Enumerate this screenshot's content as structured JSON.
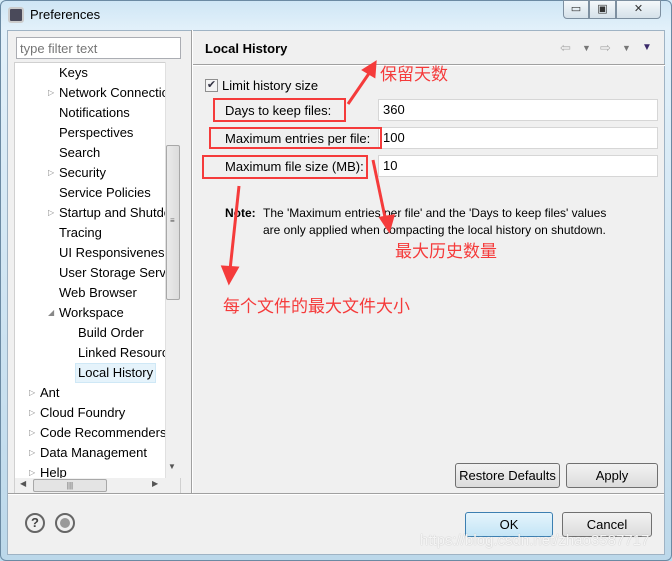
{
  "window": {
    "title": "Preferences",
    "minimize": "▭",
    "maximize": "▣",
    "close": "✕"
  },
  "filter": {
    "placeholder": "type filter text"
  },
  "tree": [
    {
      "label": "Keys",
      "level": 1,
      "expander": ""
    },
    {
      "label": "Network Connections",
      "level": 1,
      "expander": "▷"
    },
    {
      "label": "Notifications",
      "level": 1,
      "expander": ""
    },
    {
      "label": "Perspectives",
      "level": 1,
      "expander": ""
    },
    {
      "label": "Search",
      "level": 1,
      "expander": ""
    },
    {
      "label": "Security",
      "level": 1,
      "expander": "▷"
    },
    {
      "label": "Service Policies",
      "level": 1,
      "expander": ""
    },
    {
      "label": "Startup and Shutdown",
      "level": 1,
      "expander": "▷"
    },
    {
      "label": "Tracing",
      "level": 1,
      "expander": ""
    },
    {
      "label": "UI Responsiveness",
      "level": 1,
      "expander": ""
    },
    {
      "label": "User Storage Service",
      "level": 1,
      "expander": ""
    },
    {
      "label": "Web Browser",
      "level": 1,
      "expander": ""
    },
    {
      "label": "Workspace",
      "level": 1,
      "expander": "◢"
    },
    {
      "label": "Build Order",
      "level": 2,
      "expander": ""
    },
    {
      "label": "Linked Resources",
      "level": 2,
      "expander": ""
    },
    {
      "label": "Local History",
      "level": 2,
      "expander": "",
      "selected": true
    },
    {
      "label": "Ant",
      "level": 0,
      "expander": "▷"
    },
    {
      "label": "Cloud Foundry",
      "level": 0,
      "expander": "▷"
    },
    {
      "label": "Code Recommenders",
      "level": 0,
      "expander": "▷"
    },
    {
      "label": "Data Management",
      "level": 0,
      "expander": "▷"
    },
    {
      "label": "Help",
      "level": 0,
      "expander": "▷"
    }
  ],
  "page": {
    "title": "Local History",
    "limit_checkbox": {
      "label": "Limit history size",
      "checked": true
    },
    "fields": [
      {
        "label": "Days to keep files:",
        "value": "360"
      },
      {
        "label": "Maximum entries per file:",
        "value": "100"
      },
      {
        "label": "Maximum file size (MB):",
        "value": "10"
      }
    ],
    "note_label": "Note:",
    "note_line1": "The 'Maximum entries per file' and the 'Days to keep files' values",
    "note_line2": "are only applied when compacting the local history on shutdown.",
    "restore_defaults": "Restore Defaults",
    "apply": "Apply"
  },
  "footer": {
    "ok": "OK",
    "cancel": "Cancel",
    "help": "?"
  },
  "annotations": {
    "days": "保留天数",
    "entries": "最大历史数量",
    "size": "每个文件的最大文件大小",
    "color": "#f53b3b"
  },
  "watermark": "https://blog.csdn.net/zhao3587717"
}
